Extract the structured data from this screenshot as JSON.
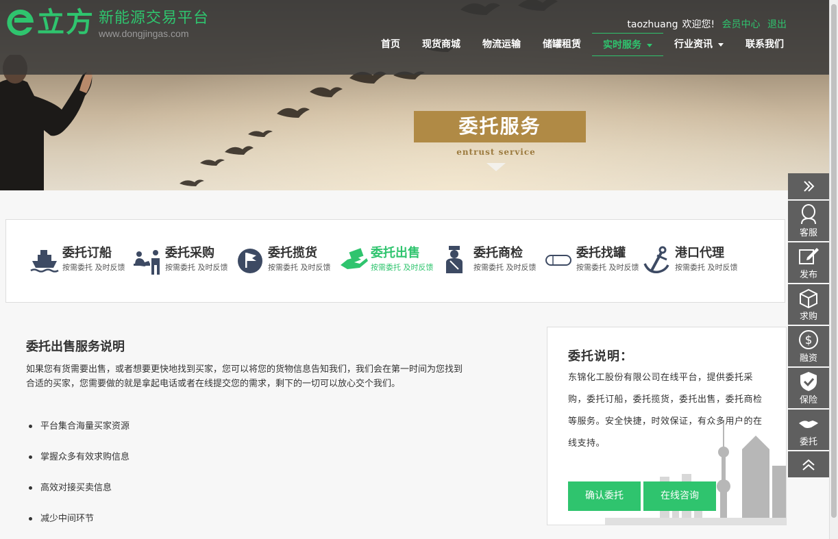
{
  "header": {
    "logo_main": "立方",
    "logo_cn": "新能源交易平台",
    "logo_url": "www.dongjingas.com",
    "username": "taozhuang",
    "welcome": "欢迎您!",
    "member_center": "会员中心",
    "logout": "退出"
  },
  "nav": {
    "items": [
      {
        "label": "首页"
      },
      {
        "label": "现货商城"
      },
      {
        "label": "物流运输"
      },
      {
        "label": "储罐租赁"
      },
      {
        "label": "实时服务",
        "active": true,
        "dropdown": true
      },
      {
        "label": "行业资讯",
        "dropdown": true
      },
      {
        "label": "联系我们"
      }
    ]
  },
  "banner": {
    "title": "委托服务",
    "subtitle": "entrust service"
  },
  "services": [
    {
      "title": "委托订船",
      "desc": "按需委托 及时反馈",
      "icon": "ship-icon"
    },
    {
      "title": "委托采购",
      "desc": "按需委托 及时反馈",
      "icon": "purchase-desk-icon"
    },
    {
      "title": "委托揽货",
      "desc": "按需委托 及时反馈",
      "icon": "flag-icon"
    },
    {
      "title": "委托出售",
      "desc": "按需委托 及时反馈",
      "icon": "sell-hand-icon",
      "active": true
    },
    {
      "title": "委托商检",
      "desc": "按需委托 及时反馈",
      "icon": "inspector-icon"
    },
    {
      "title": "委托找罐",
      "desc": "按需委托 及时反馈",
      "icon": "tank-icon"
    },
    {
      "title": "港口代理",
      "desc": "按需委托 及时反馈",
      "icon": "anchor-icon"
    }
  ],
  "main": {
    "title": "委托出售服务说明",
    "paragraph": "如果您有货需要出售，或者想要更快地找到买家，您可以将您的货物信息告知我们，我们会在第一时间为您找到合适的买家，您需要做的就是拿起电话或者在线提交您的需求，剩下的一切可以放心交个我们。",
    "features": [
      "平台集合海量买家资源",
      "掌握众多有效求购信息",
      "高效对接买卖信息",
      "减少中间环节"
    ]
  },
  "panel": {
    "title": "委托说明：",
    "text": "东锦化工股份有限公司在线平台，提供委托采购，委托订船，委托揽货，委托出售，委托商检等服务。安全快捷，时效保证，有众多用户的在线支持。",
    "confirm_button": "确认委托",
    "consult_button": "在线咨询"
  },
  "sidebar": {
    "items": [
      {
        "label": "",
        "icon": "double-chevron-right-icon"
      },
      {
        "label": "客服",
        "icon": "customer-service-icon"
      },
      {
        "label": "发布",
        "icon": "edit-icon"
      },
      {
        "label": "求购",
        "icon": "box-icon"
      },
      {
        "label": "融资",
        "icon": "dollar-icon"
      },
      {
        "label": "保险",
        "icon": "shield-check-icon"
      },
      {
        "label": "委托",
        "icon": "handshake-icon"
      },
      {
        "label": "",
        "icon": "double-chevron-up-icon"
      }
    ]
  },
  "colors": {
    "accent": "#2fc46e",
    "banner_gold": "#b08a45",
    "sidebar_bg": "#5f5f5f",
    "nav_bg": "#3a3a3a"
  }
}
